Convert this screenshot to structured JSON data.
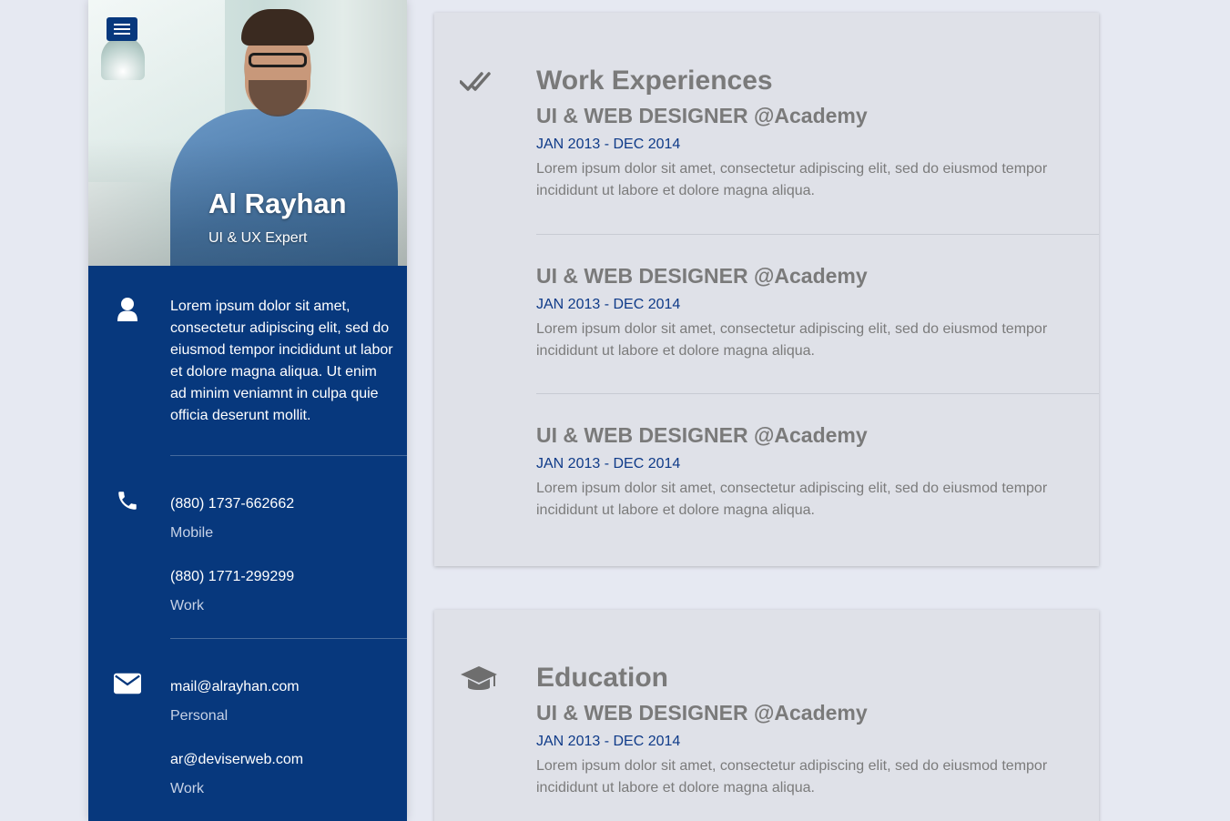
{
  "profile": {
    "name": "Al Rayhan",
    "role": "UI & UX Expert",
    "about": "Lorem ipsum dolor sit amet, consectetur adipiscing elit, sed do eiusmod tempor incididunt ut labor et dolore magna aliqua. Ut enim ad minim veniamnt in culpa quie officia deserunt mollit."
  },
  "phones": [
    {
      "number": "(880) 1737-662662",
      "label": "Mobile"
    },
    {
      "number": "(880) 1771-299299",
      "label": "Work"
    }
  ],
  "emails": [
    {
      "address": "mail@alrayhan.com",
      "label": "Personal"
    },
    {
      "address": "ar@deviserweb.com",
      "label": "Work"
    }
  ],
  "work": {
    "title": "Work Experiences",
    "entries": [
      {
        "role": "UI & WEB DESIGNER @Academy",
        "date": "JAN 2013 - DEC 2014",
        "desc": "Lorem ipsum dolor sit amet, consectetur adipiscing elit, sed do eiusmod tempor incididunt ut labore et dolore magna aliqua."
      },
      {
        "role": "UI & WEB DESIGNER @Academy",
        "date": "JAN 2013 - DEC 2014",
        "desc": "Lorem ipsum dolor sit amet, consectetur adipiscing elit, sed do eiusmod tempor incididunt ut labore et dolore magna aliqua."
      },
      {
        "role": "UI & WEB DESIGNER @Academy",
        "date": "JAN 2013 - DEC 2014",
        "desc": "Lorem ipsum dolor sit amet, consectetur adipiscing elit, sed do eiusmod tempor incididunt ut labore et dolore magna aliqua."
      }
    ]
  },
  "education": {
    "title": "Education",
    "entries": [
      {
        "role": "UI & WEB DESIGNER @Academy",
        "date": "JAN 2013 - DEC 2014",
        "desc": "Lorem ipsum dolor sit amet, consectetur adipiscing elit, sed do eiusmod tempor incididunt ut labore et dolore magna aliqua."
      }
    ]
  },
  "icons": {
    "menu": "hamburger-menu-icon",
    "about": "user-icon",
    "phone": "phone-icon",
    "email": "envelope-icon",
    "work": "double-check-icon",
    "education": "graduation-cap-icon"
  },
  "colors": {
    "sidebar": "#07387d",
    "accent_date": "#0e3a88",
    "page_bg": "#e6e9f2",
    "card_bg": "#dfe1e8"
  }
}
